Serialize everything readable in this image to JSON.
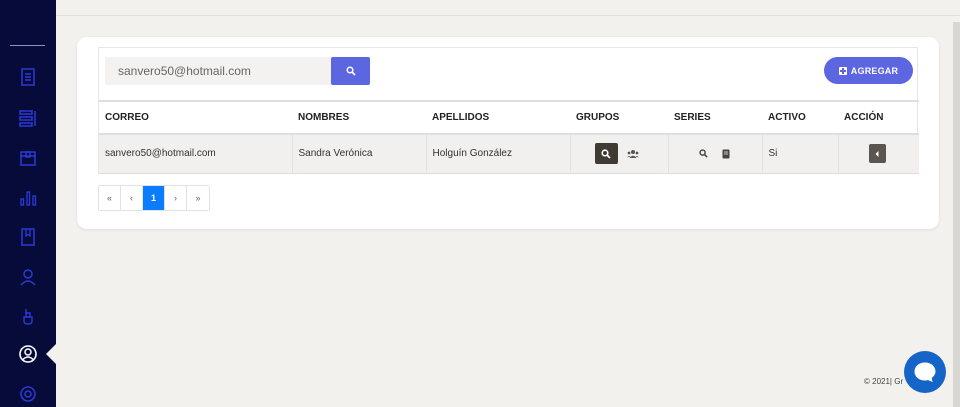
{
  "sidebar": {
    "items": [
      {
        "icon": "list-icon"
      },
      {
        "icon": "rows-icon"
      },
      {
        "icon": "box-icon"
      },
      {
        "icon": "bar-chart-icon"
      },
      {
        "icon": "book-icon"
      },
      {
        "icon": "user-icon"
      },
      {
        "icon": "hand-icon"
      },
      {
        "icon": "user-circle-icon",
        "active": true
      },
      {
        "icon": "gear-icon"
      }
    ]
  },
  "search": {
    "value": "sanvero50@hotmail.com"
  },
  "toolbar": {
    "add_label": "AGREGAR"
  },
  "table": {
    "headers": {
      "correo": "CORREO",
      "nombres": "NOMBRES",
      "apellidos": "APELLIDOS",
      "grupos": "GRUPOS",
      "series": "SERIES",
      "activo": "ACTIVO",
      "accion": "ACCIÓN"
    },
    "rows": [
      {
        "correo": "sanvero50@hotmail.com",
        "nombres": "Sandra Verónica",
        "apellidos": "Holguín González",
        "activo": "Si"
      }
    ]
  },
  "pagination": {
    "first": "«",
    "prev": "‹",
    "current": "1",
    "next": "›",
    "last": "»"
  },
  "footer": {
    "text": "© 2021| Gr"
  },
  "colors": {
    "sidebar": "#070b3a",
    "accent": "#5b66e0",
    "page_active": "#0a7dff",
    "chat": "#1565c8"
  }
}
